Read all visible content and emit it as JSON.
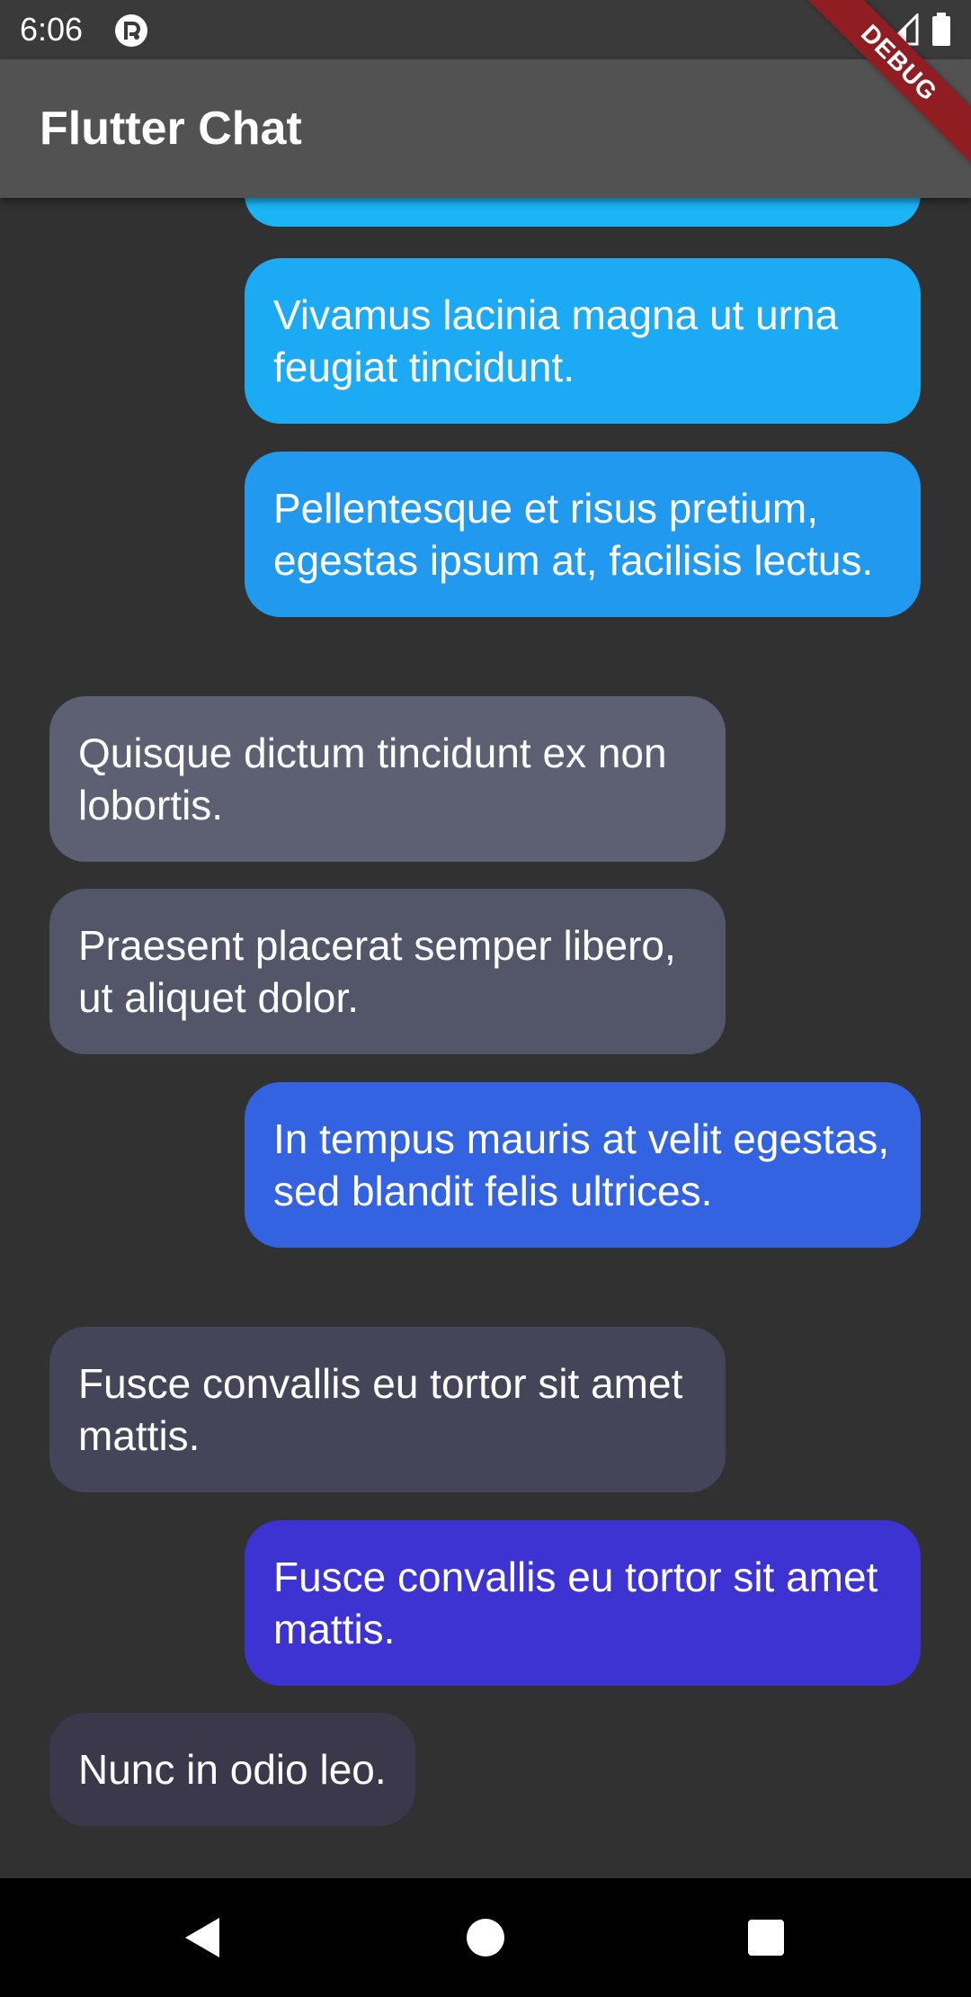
{
  "status_bar": {
    "time": "6:06",
    "icons": [
      "app-notification-icon",
      "wifi-icon",
      "signal-icon",
      "battery-icon"
    ]
  },
  "app_bar": {
    "title": "Flutter Chat"
  },
  "debug_banner": {
    "label": "DEBUG"
  },
  "colors": {
    "background": "#313131",
    "app_bar": "#525252",
    "status_bar": "#3a3a3a",
    "debug_banner": "#8f1d21",
    "nav_bar": "#000000"
  },
  "messages": [
    {
      "sender": "me",
      "text": "",
      "color": "#1bb4f5"
    },
    {
      "sender": "me",
      "text": "Vivamus lacinia magna ut urna feugiat tincidunt.",
      "color": "#1caaf4"
    },
    {
      "sender": "me",
      "text": "Pellentesque et risus pretium, egestas ipsum at, facilisis lectus.",
      "color": "#2199ef"
    },
    {
      "sender": "them",
      "text": "Quisque dictum tincidunt ex non lobortis.",
      "color": "#5d6073"
    },
    {
      "sender": "them",
      "text": "Praesent placerat semper libero, ut aliquet dolor.",
      "color": "#535669"
    },
    {
      "sender": "me",
      "text": "In tempus mauris at velit egestas, sed blandit felis ultrices.",
      "color": "#3463e2"
    },
    {
      "sender": "them",
      "text": "Fusce convallis eu tortor sit amet mattis.",
      "color": "#45455a"
    },
    {
      "sender": "me",
      "text": "Fusce convallis eu tortor sit amet mattis.",
      "color": "#3d33d3"
    },
    {
      "sender": "them",
      "text": "Nunc in odio leo.",
      "color": "#3b384c"
    }
  ],
  "nav_bar": {
    "buttons": [
      "back-icon",
      "home-icon",
      "recents-icon"
    ]
  }
}
